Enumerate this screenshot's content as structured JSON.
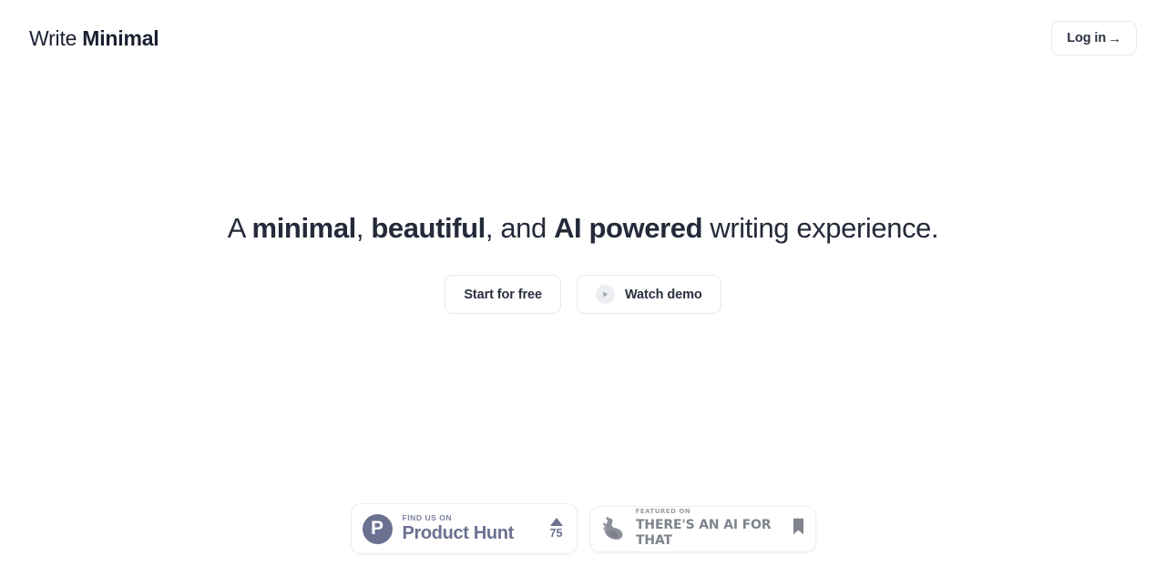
{
  "header": {
    "brand": {
      "word_light": "Write",
      "word_bold": "Minimal"
    },
    "login": {
      "label": "Log in",
      "arrow": "→"
    }
  },
  "hero": {
    "headline": {
      "part1": "A ",
      "bold1": "minimal",
      "part2": ", ",
      "bold2": "beautiful",
      "part3": ", and ",
      "bold3": "AI powered",
      "part4": " writing experience."
    },
    "cta_primary": "Start for free",
    "cta_secondary": "Watch demo"
  },
  "badges": {
    "product_hunt": {
      "logo_letter": "P",
      "kicker": "FIND US ON",
      "name": "Product Hunt",
      "upvote_count": "75"
    },
    "theres_an_ai_for_that": {
      "kicker": "FEATURED ON",
      "name": "THERE'S AN AI FOR THAT"
    }
  },
  "colors": {
    "text_primary": "#252a3a",
    "border": "#e7e8ec",
    "product_hunt_purple": "#6b7191",
    "taft_gray": "#7f848c",
    "background": "#ffffff"
  }
}
